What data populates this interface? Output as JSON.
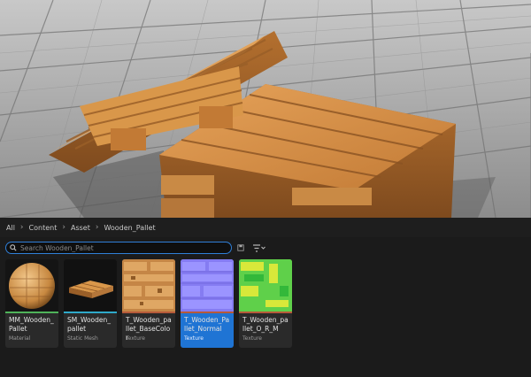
{
  "breadcrumb": {
    "items": [
      "All",
      "Content",
      "Asset",
      "Wooden_Pallet"
    ]
  },
  "search": {
    "placeholder": "Search Wooden_Pallet"
  },
  "assets": [
    {
      "name": "MM_Wooden_Pallet",
      "type": "Material",
      "bar_color": "#4fb35a",
      "selected": false
    },
    {
      "name": "SM_Wooden_pallet",
      "type": "Static Mesh",
      "bar_color": "#2fa9c9",
      "selected": false
    },
    {
      "name": "T_Wooden_pallet_BaseColor",
      "type": "Texture",
      "bar_color": "#b65a3a",
      "selected": false
    },
    {
      "name": "T_Wooden_Pallet_Normal",
      "type": "Texture",
      "bar_color": "#b65a3a",
      "selected": true
    },
    {
      "name": "T_Wooden_pallet_O_R_M",
      "type": "Texture",
      "bar_color": "#b65a3a",
      "selected": false
    }
  ],
  "colors": {
    "accent": "#1f74d4",
    "wood": "#d9974a",
    "floor": "#9a9a9a"
  }
}
